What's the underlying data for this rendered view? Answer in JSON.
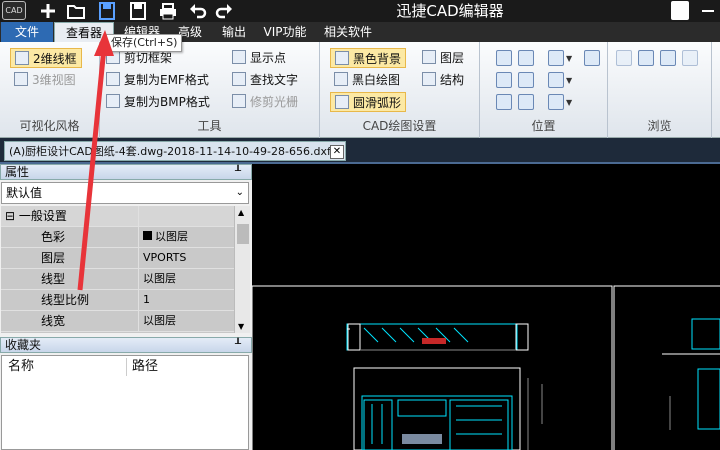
{
  "window": {
    "title": "迅捷CAD编辑器",
    "logo_text": "CAD"
  },
  "menubar": {
    "items": [
      "文件",
      "查看器",
      "编辑器",
      "高级",
      "输出",
      "VIP功能",
      "相关软件"
    ],
    "active": "查看器"
  },
  "tooltip": "保存(Ctrl+S)",
  "ribbon": {
    "groups": {
      "visual": {
        "label": "可视化风格",
        "btn_2d": "2维线框",
        "btn_3d": "3维视图"
      },
      "tools": {
        "label": "工具",
        "buttons": [
          "剪切框架",
          "复制为EMF格式",
          "复制为BMP格式",
          "显示点",
          "查找文字",
          "修剪光栅"
        ]
      },
      "settings": {
        "label": "CAD绘图设置",
        "buttons": [
          "黑色背景",
          "黑白绘图",
          "圆滑弧形",
          "图层",
          "结构"
        ]
      },
      "position": {
        "label": "位置"
      },
      "browse": {
        "label": "浏览"
      }
    }
  },
  "document_tab": {
    "name": "(A)厨柜设计CAD图纸-4套.dwg-2018-11-14-10-49-28-656.dxf"
  },
  "properties": {
    "title": "属性",
    "selector_value": "默认值",
    "category": "一般设置",
    "rows": [
      {
        "name": "色彩",
        "value": "以图层"
      },
      {
        "name": "图层",
        "value": "VPORTS"
      },
      {
        "name": "线型",
        "value": "以图层"
      },
      {
        "name": "线型比例",
        "value": "1"
      },
      {
        "name": "线宽",
        "value": "以图层"
      }
    ]
  },
  "favorites": {
    "title": "收藏夹",
    "columns": [
      "名称",
      "路径"
    ]
  },
  "colors": {
    "accent": "#2d6ab3",
    "titlebar": "#1a1a1a",
    "cad_line": "#00e5ff",
    "arrow": "#e8343a"
  }
}
